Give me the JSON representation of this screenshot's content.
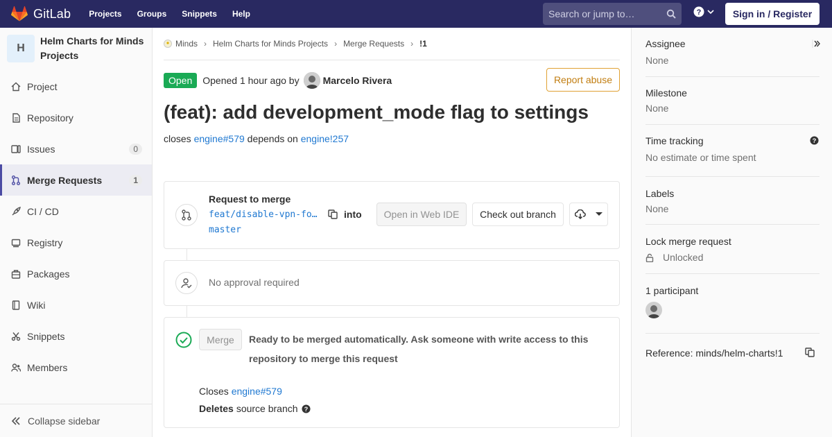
{
  "navbar": {
    "brand": "GitLab",
    "links": [
      "Projects",
      "Groups",
      "Snippets",
      "Help"
    ],
    "search_placeholder": "Search or jump to…",
    "signin": "Sign in / Register"
  },
  "sidebar": {
    "project_initial": "H",
    "project_name": "Helm Charts for Minds Projects",
    "items": [
      {
        "label": "Project",
        "icon": "home-icon"
      },
      {
        "label": "Repository",
        "icon": "doc-icon"
      },
      {
        "label": "Issues",
        "icon": "issues-icon",
        "count": "0"
      },
      {
        "label": "Merge Requests",
        "icon": "merge-request-icon",
        "count": "1",
        "active": true
      },
      {
        "label": "CI / CD",
        "icon": "rocket-icon"
      },
      {
        "label": "Registry",
        "icon": "container-icon"
      },
      {
        "label": "Packages",
        "icon": "package-icon"
      },
      {
        "label": "Wiki",
        "icon": "book-icon"
      },
      {
        "label": "Snippets",
        "icon": "scissors-icon"
      },
      {
        "label": "Members",
        "icon": "users-icon"
      }
    ],
    "collapse_label": "Collapse sidebar"
  },
  "breadcrumb": [
    "Minds",
    "Helm Charts for Minds Projects",
    "Merge Requests",
    "!1"
  ],
  "mr": {
    "status": "Open",
    "opened_text": "Opened 1 hour ago by",
    "author": "Marcelo Rivera",
    "report_label": "Report abuse",
    "title": "(feat): add development_mode flag to settings",
    "desc_prefix": "closes",
    "desc_link1": "engine#579",
    "desc_mid": "depends on",
    "desc_link2": "engine!257"
  },
  "request": {
    "title": "Request to merge",
    "source_branch": "feat/disable-vpn-fo…",
    "into": "into",
    "target_branch": "master",
    "web_ide": "Open in Web IDE",
    "checkout": "Check out branch"
  },
  "approval": {
    "text": "No approval required"
  },
  "merge": {
    "button": "Merge",
    "message": "Ready to be merged automatically. Ask someone with write access to this repository to merge this request",
    "closes_label": "Closes",
    "closes_link": "engine#579",
    "deletes_label": "Deletes",
    "deletes_rest": "source branch"
  },
  "right_sidebar": {
    "assignee_title": "Assignee",
    "assignee_value": "None",
    "milestone_title": "Milestone",
    "milestone_value": "None",
    "time_title": "Time tracking",
    "time_value": "No estimate or time spent",
    "labels_title": "Labels",
    "labels_value": "None",
    "lock_title": "Lock merge request",
    "lock_value": "Unlocked",
    "participants_title": "1 participant",
    "reference": "Reference: minds/helm-charts!1"
  },
  "colors": {
    "navbar": "#292961",
    "open_badge": "#1aaa55",
    "link": "#1f78d1",
    "report": "#e0a133"
  }
}
